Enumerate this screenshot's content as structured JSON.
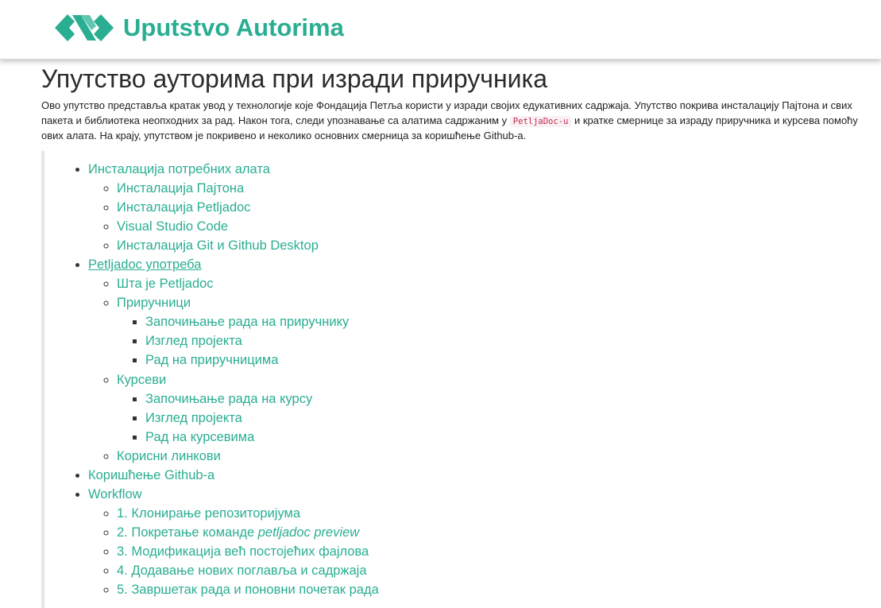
{
  "header": {
    "brand": "Uputstvo Autorima",
    "logo_icon": "petlja-logo-icon",
    "accent_color": "#2aae92"
  },
  "page": {
    "title": "Упутство ауторима при изради приручника",
    "intro_part1": "Ово упутство представља кратак увод у технологије које Фондација Петља користи у изради својих едукативних садржаја. Упутство покрива инсталацију Пајтона и свих пакета и библиотека неопходних за рад. Након тога, следи упознавање са алатима садржаним у ",
    "intro_code": "PetljaDoc-u",
    "intro_part2": " и кратке смернице за израду приручника и курсева помоћу ових алата. На крају, упутством је покривено и неколико основних смерница за коришћење Github-а."
  },
  "toc": {
    "installation": {
      "label": "Инсталација потребних алата",
      "items": [
        "Инсталација Пајтона",
        "Инсталација Petljadoc",
        "Visual Studio Code",
        "Инсталација Git и Github Desktop"
      ]
    },
    "usage": {
      "label": "Petljadoc употреба",
      "what": "Шта је Petljadoc",
      "manuals": {
        "label": "Приручници",
        "items": [
          "Започињање рада на приручнику",
          "Изглед пројекта",
          "Рад на приручницима"
        ]
      },
      "courses": {
        "label": "Курсеви",
        "items": [
          "Започињање рада на курсу",
          "Изглед пројекта",
          "Рад на курсевима"
        ]
      },
      "links": "Корисни линкови"
    },
    "github": "Коришћење Github-а",
    "workflow": {
      "label": "Workflow",
      "step1": "1. Клонирање репозиторијума",
      "step2_prefix": "2. Покретање команде ",
      "step2_cmd": "petljadoc preview",
      "step3": "3. Модификација већ постојећих фајлова",
      "step4": "4. Додавање нових поглавља и садржаја",
      "step5": "5. Завршетак рада и поновни почетак рада"
    }
  }
}
